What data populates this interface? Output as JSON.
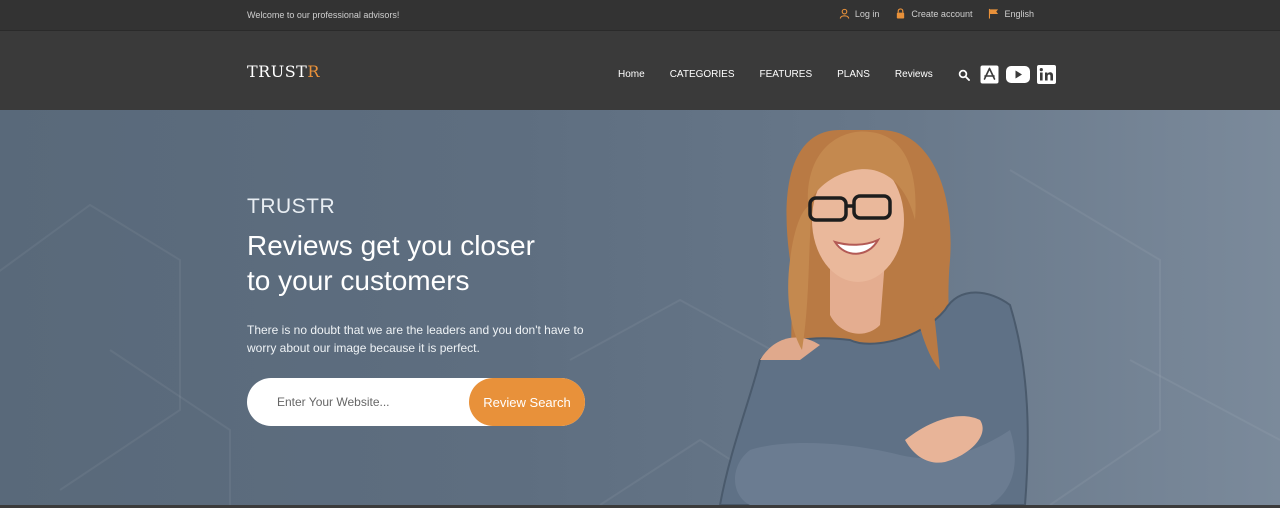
{
  "topbar": {
    "welcome": "Welcome to our professional advisors!",
    "login": "Log in",
    "create_account": "Create account",
    "language": "English"
  },
  "logo": {
    "main": "TRUST",
    "accent": "R"
  },
  "nav": {
    "items": [
      "Home",
      "CATEGORIES",
      "FEATURES",
      "PLANS",
      "Reviews"
    ],
    "icons": [
      "search-icon",
      "app-store-icon",
      "youtube-icon",
      "linkedin-icon"
    ]
  },
  "hero": {
    "brand": "TRUSTR",
    "headline_line1": "Reviews get you closer",
    "headline_line2": "to your customers",
    "description": "There is no doubt that we are the leaders and you don't have to worry about our image because it is perfect.",
    "search_placeholder": "Enter Your Website...",
    "search_button": "Review Search"
  },
  "colors": {
    "accent": "#e8913a",
    "topbar_bg": "#333333",
    "navbar_bg": "#3a3a3a",
    "hero_bg": "#5e6e80"
  }
}
